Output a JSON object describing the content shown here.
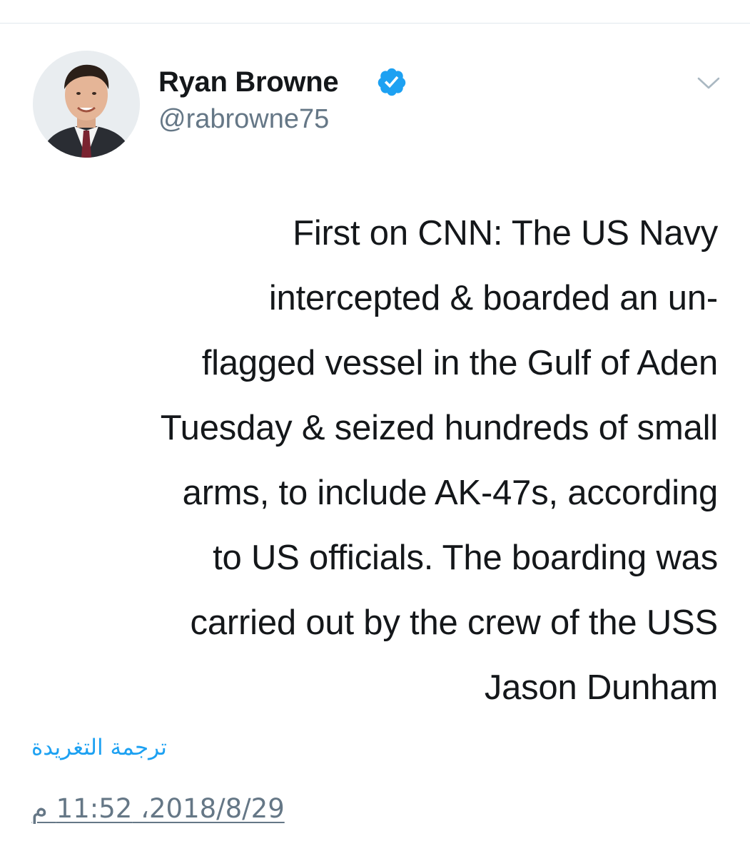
{
  "author": {
    "display_name": "Ryan Browne",
    "handle": "@rabrowne75",
    "verified": true,
    "verified_color": "#1da1f2"
  },
  "tweet": {
    "lines": [
      "First on CNN: The US Navy",
      "intercepted & boarded an un-",
      "flagged vessel in the Gulf of Aden",
      "Tuesday & seized hundreds of small",
      "arms, to include AK-47s, according",
      "to US officials. The boarding was",
      "carried out by the crew of the USS",
      "Jason Dunham"
    ]
  },
  "footer": {
    "translate_label": "ترجمة التغريدة",
    "timestamp": "2018/8/29، 11:52 م"
  },
  "icons": {
    "verified": "verified-badge-icon",
    "more": "chevron-down-icon"
  },
  "colors": {
    "link": "#1da1f2",
    "secondary_text": "#657786",
    "primary_text": "#14171a"
  }
}
